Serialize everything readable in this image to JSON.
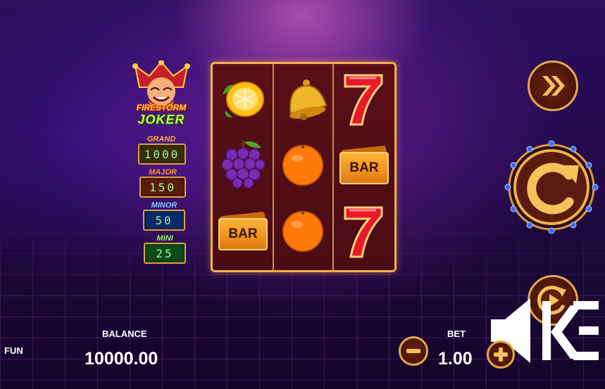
{
  "game": {
    "logo_line1": "FIRESTORM",
    "logo_line2": "JOKER"
  },
  "jackpots": [
    {
      "name": "GRAND",
      "value": "1000",
      "label_color": "#ffb03a",
      "box_color": "#3a2d05"
    },
    {
      "name": "MAJOR",
      "value": "150",
      "label_color": "#ff9a1e",
      "box_color": "#5a1c05"
    },
    {
      "name": "MINOR",
      "value": "50",
      "label_color": "#7ecbff",
      "box_color": "#0d2a6a"
    },
    {
      "name": "MINI",
      "value": "25",
      "label_color": "#8fff57",
      "box_color": "#0f4a1a"
    }
  ],
  "reels": [
    [
      "lemon",
      "grapes",
      "bar"
    ],
    [
      "bell",
      "orange",
      "orange"
    ],
    [
      "seven",
      "bar",
      "seven"
    ]
  ],
  "symbol_text": {
    "bar": "BAR"
  },
  "controls": {
    "fast_icon": "double-chevron-right-icon",
    "spin_icon": "spin-arrow-icon",
    "autoplay_icon": "autoplay-icon",
    "minus_icon": "minus-icon",
    "plus_icon": "plus-icon",
    "sound_icon": "speaker-icon",
    "menu_icon": "menu-icon"
  },
  "hud": {
    "mode": "FUN",
    "balance_label": "BALANCE",
    "balance_value": "10000.00",
    "bet_label": "BET",
    "bet_value": "1.00"
  },
  "colors": {
    "gold": "#f0b04a",
    "reel_bg": "#4a0c14",
    "spin_bg": "#5a1b10"
  }
}
